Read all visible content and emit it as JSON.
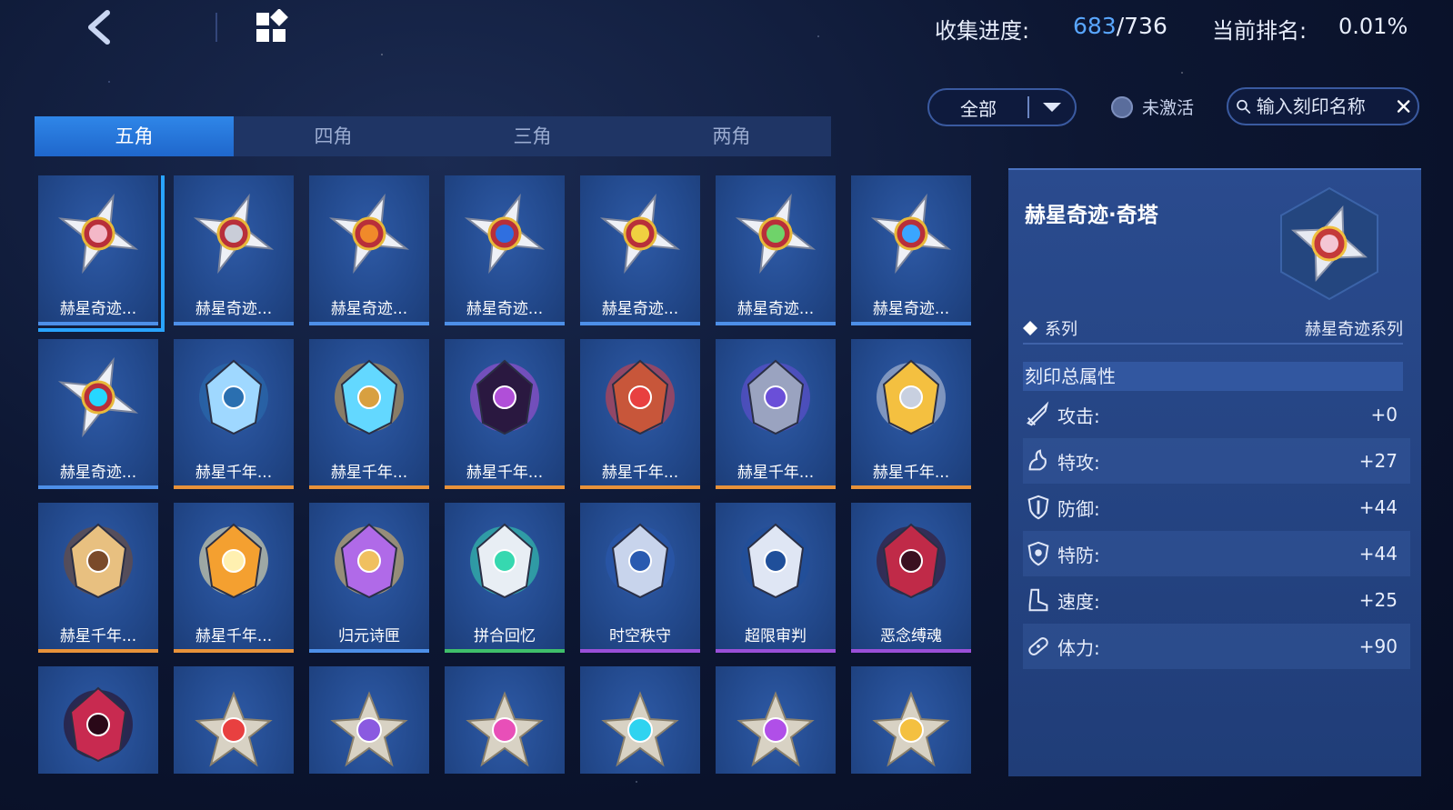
{
  "header": {
    "progress_label": "收集进度:",
    "progress_current": "683",
    "progress_total": "/736",
    "rank_label": "当前排名:",
    "rank_value": "0.01%"
  },
  "filter": {
    "selected": "全部",
    "inactive_label": "未激活",
    "search_placeholder": "输入刻印名称"
  },
  "tabs": [
    {
      "label": "五角",
      "active": true
    },
    {
      "label": "四角",
      "active": false
    },
    {
      "label": "三角",
      "active": false
    },
    {
      "label": "两角",
      "active": false
    }
  ],
  "cards": [
    {
      "label": "赫星奇迹...",
      "emblem": "shuriken-pink",
      "rarity": "blue"
    },
    {
      "label": "赫星奇迹...",
      "emblem": "shuriken-grey",
      "rarity": "blue"
    },
    {
      "label": "赫星奇迹...",
      "emblem": "shuriken-orange",
      "rarity": "blue"
    },
    {
      "label": "赫星奇迹...",
      "emblem": "shuriken-yellow",
      "rarity": "blue"
    },
    {
      "label": "赫星奇迹...",
      "emblem": "shuriken-gold",
      "rarity": "blue"
    },
    {
      "label": "赫星奇迹...",
      "emblem": "shuriken-green",
      "rarity": "blue"
    },
    {
      "label": "赫星奇迹...",
      "emblem": "shuriken-blue",
      "rarity": "blue"
    },
    {
      "label": "赫星奇迹...",
      "emblem": "shuriken-cyan",
      "rarity": "blue"
    },
    {
      "label": "赫星千年...",
      "emblem": "gear-ring",
      "rarity": "orange"
    },
    {
      "label": "赫星千年...",
      "emblem": "lightning-ring",
      "rarity": "orange"
    },
    {
      "label": "赫星千年...",
      "emblem": "black-hole",
      "rarity": "orange"
    },
    {
      "label": "赫星千年...",
      "emblem": "robot-eyes",
      "rarity": "orange"
    },
    {
      "label": "赫星千年...",
      "emblem": "armor-crest",
      "rarity": "orange"
    },
    {
      "label": "赫星千年...",
      "emblem": "winged-helm",
      "rarity": "orange"
    },
    {
      "label": "赫星千年...",
      "emblem": "golden-eye",
      "rarity": "orange"
    },
    {
      "label": "赫星千年...",
      "emblem": "flame-shield",
      "rarity": "orange"
    },
    {
      "label": "归元诗匣",
      "emblem": "crystal-orb",
      "rarity": "blue"
    },
    {
      "label": "拼合回忆",
      "emblem": "robot-head",
      "rarity": "green"
    },
    {
      "label": "时空秩守",
      "emblem": "silver-shield",
      "rarity": "purple"
    },
    {
      "label": "超限审判",
      "emblem": "silver-wing",
      "rarity": "purple"
    },
    {
      "label": "恶念缚魂",
      "emblem": "demon-crest",
      "rarity": "purple"
    },
    {
      "label": "",
      "emblem": "demon-claw",
      "rarity": "none"
    },
    {
      "label": "",
      "emblem": "red-star",
      "rarity": "none"
    },
    {
      "label": "",
      "emblem": "purple-star",
      "rarity": "none"
    },
    {
      "label": "",
      "emblem": "pink-gem-star",
      "rarity": "none"
    },
    {
      "label": "",
      "emblem": "cyan-gem-star",
      "rarity": "none"
    },
    {
      "label": "",
      "emblem": "violet-gem-star",
      "rarity": "none"
    },
    {
      "label": "",
      "emblem": "gold-gem-star",
      "rarity": "none"
    }
  ],
  "detail": {
    "title": "赫星奇迹·奇塔",
    "series_key": "系列",
    "series_value": "赫星奇迹系列",
    "section_title": "刻印总属性",
    "stats": [
      {
        "name": "攻击:",
        "value": "+0",
        "icon": "sword-icon"
      },
      {
        "name": "特攻:",
        "value": "+27",
        "icon": "flame-hand-icon"
      },
      {
        "name": "防御:",
        "value": "+44",
        "icon": "shield-icon"
      },
      {
        "name": "特防:",
        "value": "+44",
        "icon": "magic-shield-icon"
      },
      {
        "name": "速度:",
        "value": "+25",
        "icon": "boot-icon"
      },
      {
        "name": "体力:",
        "value": "+90",
        "icon": "bandage-icon"
      }
    ]
  },
  "colors": {
    "accent": "#29a4ff",
    "rarity_blue": "#4d8fe8",
    "rarity_orange": "#e8923a",
    "rarity_green": "#3fbf6a",
    "rarity_purple": "#9a4fd8"
  }
}
